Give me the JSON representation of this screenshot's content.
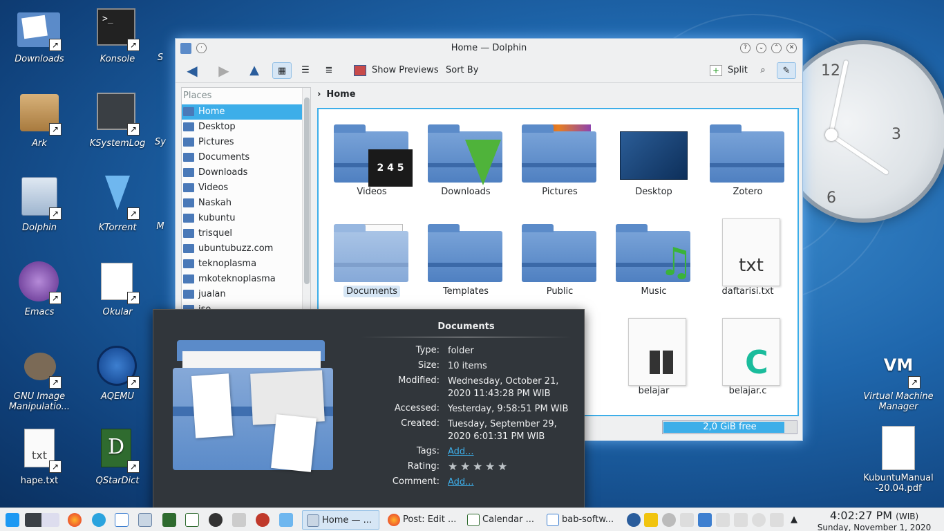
{
  "desktop": {
    "icons": [
      {
        "label": "Downloads"
      },
      {
        "label": "Konsole"
      },
      {
        "label": "Ark"
      },
      {
        "label": "KSystemLog"
      },
      {
        "label": "Dolphin"
      },
      {
        "label": "KTorrent"
      },
      {
        "label": "Emacs"
      },
      {
        "label": "Okular"
      },
      {
        "label": "GNU Image Manipulatio..."
      },
      {
        "label": "AQEMU"
      },
      {
        "label": "hape.txt"
      },
      {
        "label": "QStarDict"
      },
      {
        "label": "Virtual Machine Manager"
      },
      {
        "label": "KubuntuManual -20.04.pdf"
      }
    ],
    "partial_labels": [
      "S",
      "Sy",
      "M"
    ]
  },
  "clock_widget": {
    "numerals": [
      "12",
      "3",
      "6"
    ]
  },
  "window": {
    "title": "Home — Dolphin",
    "toolbar": {
      "show_previews": "Show Previews",
      "sort_by": "Sort By",
      "split": "Split"
    },
    "places": {
      "header": "Places",
      "items": [
        {
          "label": "Home",
          "selected": true
        },
        {
          "label": "Desktop"
        },
        {
          "label": "Pictures"
        },
        {
          "label": "Documents"
        },
        {
          "label": "Downloads"
        },
        {
          "label": "Videos"
        },
        {
          "label": "Naskah"
        },
        {
          "label": "kubuntu"
        },
        {
          "label": "trisquel"
        },
        {
          "label": "ubuntubuzz.com"
        },
        {
          "label": "teknoplasma"
        },
        {
          "label": "mkoteknoplasma"
        },
        {
          "label": "jualan"
        },
        {
          "label": "iso"
        }
      ]
    },
    "breadcrumb": "Home",
    "files": [
      {
        "label": "Videos"
      },
      {
        "label": "Downloads"
      },
      {
        "label": "Pictures"
      },
      {
        "label": "Desktop"
      },
      {
        "label": "Zotero"
      },
      {
        "label": "Documents"
      },
      {
        "label": "Templates"
      },
      {
        "label": "Public"
      },
      {
        "label": "Music"
      },
      {
        "label": "daftarisi.txt"
      },
      {
        "label": "belajar"
      },
      {
        "label": "belajar.c"
      }
    ],
    "free_space": {
      "label": "2,0 GiB free",
      "used_fraction": 0.91
    }
  },
  "tooltip": {
    "title": "Documents",
    "fields": [
      {
        "key": "Type:",
        "value": "folder"
      },
      {
        "key": "Size:",
        "value": "10 items"
      },
      {
        "key": "Modified:",
        "value": "Wednesday, October 21, 2020 11:43:28 PM WIB"
      },
      {
        "key": "Accessed:",
        "value": "Yesterday, 9:58:51 PM WIB"
      },
      {
        "key": "Created:",
        "value": "Tuesday, September 29, 2020 6:01:31 PM WIB"
      },
      {
        "key": "Tags:",
        "value": "Add..."
      },
      {
        "key": "Rating:",
        "value": ""
      },
      {
        "key": "Comment:",
        "value": "Add..."
      }
    ],
    "rating_stars": 5,
    "rating_value": 0
  },
  "taskbar": {
    "tasks": [
      {
        "label": "Home — ..."
      },
      {
        "label": "Post: Edit ..."
      },
      {
        "label": "Calendar ..."
      },
      {
        "label": "bab-softw..."
      }
    ],
    "time": "4:02:27 PM",
    "tz": "(WIB)",
    "date": "Sunday, November 1, 2020"
  },
  "colors": {
    "accent": "#3daee9",
    "folder": "#5b8bc9",
    "tooltip_bg": "#31363b"
  }
}
